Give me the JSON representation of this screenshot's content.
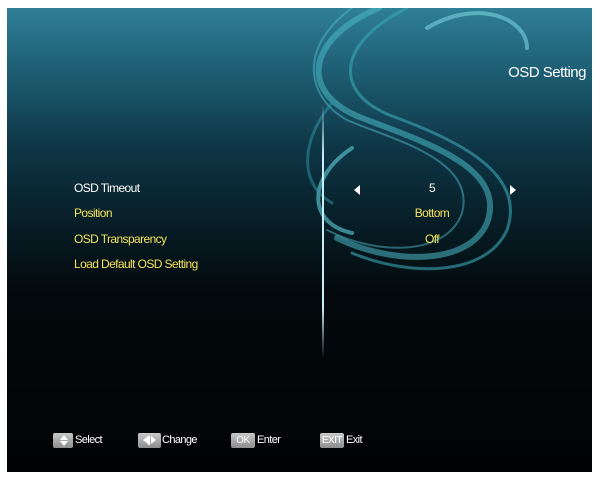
{
  "header": {
    "title": "OSD Setting"
  },
  "menu": {
    "items": [
      {
        "label": "OSD Timeout",
        "value": "5"
      },
      {
        "label": "Position",
        "value": "Bottom"
      },
      {
        "label": "OSD Transparency",
        "value": "Off"
      },
      {
        "label": "Load Default OSD Setting",
        "value": ""
      }
    ]
  },
  "footer": {
    "hints": [
      {
        "key": "",
        "key_icon": "up-down-arrows-icon",
        "label": "Select"
      },
      {
        "key": "",
        "key_icon": "left-right-arrows-icon",
        "label": "Change"
      },
      {
        "key": "OK",
        "label": "Enter"
      },
      {
        "key": "EXIT",
        "label": "Exit"
      }
    ]
  },
  "colors": {
    "selected_text": "#ffffff",
    "menu_text": "#f5e35a",
    "background_top": "#2f7f97",
    "background_bottom": "#010203"
  }
}
